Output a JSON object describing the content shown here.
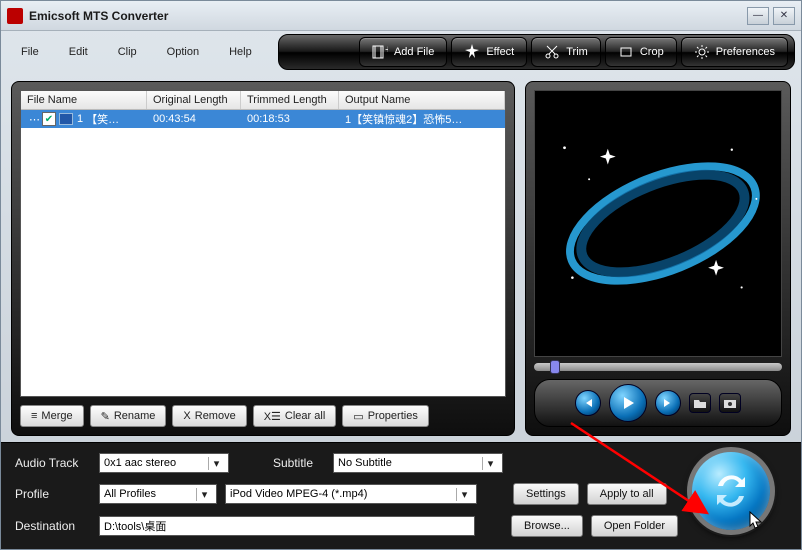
{
  "window": {
    "title": "Emicsoft MTS Converter"
  },
  "menu": {
    "file": "File",
    "edit": "Edit",
    "clip": "Clip",
    "option": "Option",
    "help": "Help"
  },
  "toolbar": {
    "add_file": "Add File",
    "effect": "Effect",
    "trim": "Trim",
    "crop": "Crop",
    "preferences": "Preferences"
  },
  "filelist": {
    "headers": {
      "name": "File Name",
      "original": "Original Length",
      "trimmed": "Trimmed Length",
      "output": "Output Name"
    },
    "rows": [
      {
        "index": "1",
        "name": "【笑…",
        "original": "00:43:54",
        "trimmed": "00:18:53",
        "output": "1【笑镇惊魂2】恐怖5…"
      }
    ]
  },
  "filebtns": {
    "merge": "Merge",
    "rename": "Rename",
    "remove": "Remove",
    "clear": "Clear all",
    "properties": "Properties"
  },
  "bottom": {
    "audio_track_label": "Audio Track",
    "audio_track_value": "0x1 aac stereo",
    "subtitle_label": "Subtitle",
    "subtitle_value": "No Subtitle",
    "profile_label": "Profile",
    "profile_group": "All Profiles",
    "profile_value": "iPod Video MPEG-4 (*.mp4)",
    "destination_label": "Destination",
    "destination_value": "D:\\tools\\桌面",
    "settings": "Settings",
    "apply_all": "Apply to all",
    "browse": "Browse...",
    "open_folder": "Open Folder"
  }
}
